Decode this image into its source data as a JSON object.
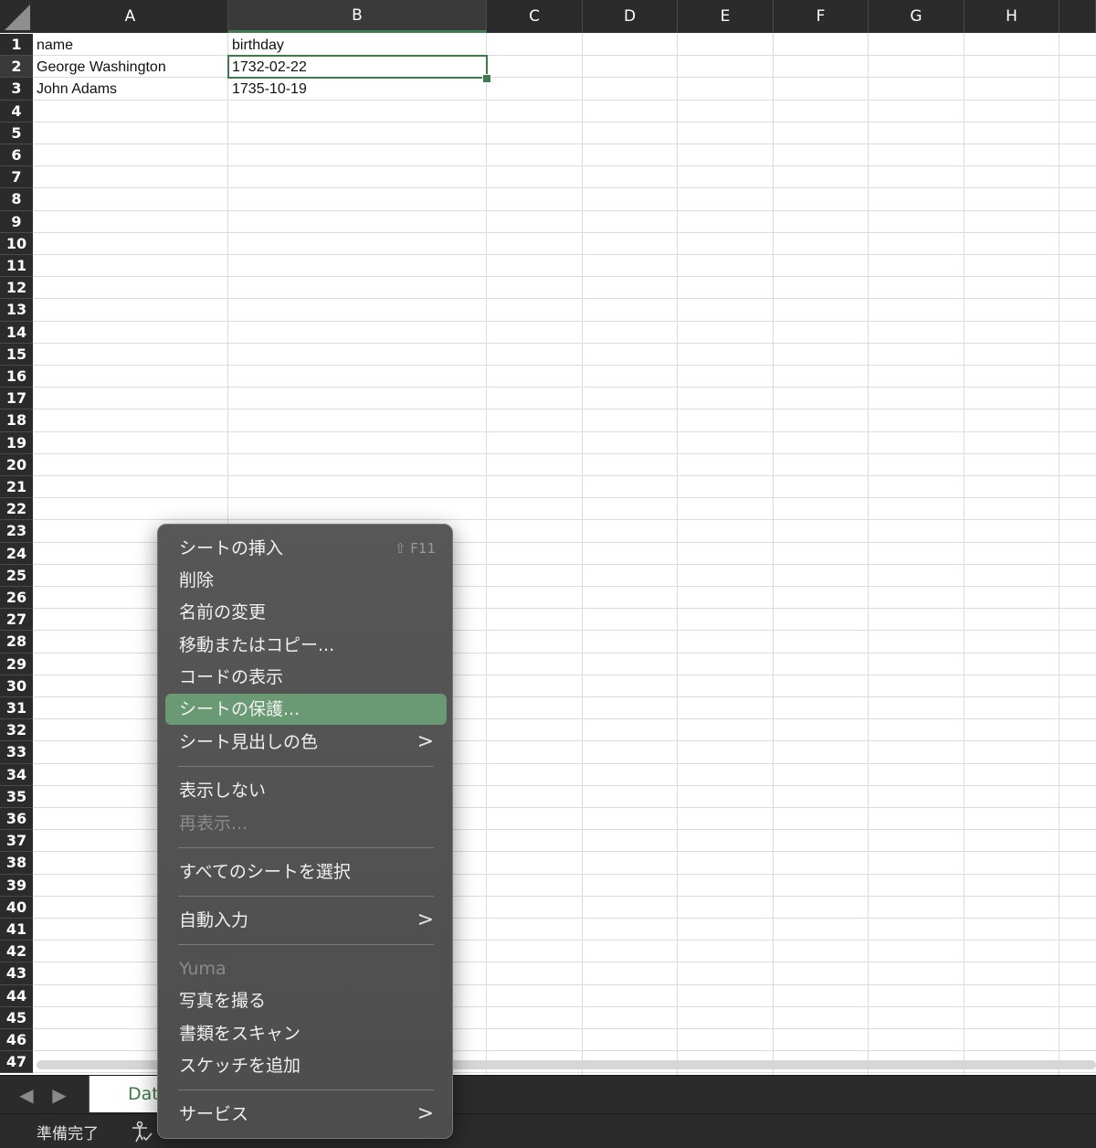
{
  "columns": [
    "A",
    "B",
    "C",
    "D",
    "E",
    "F",
    "G",
    "H"
  ],
  "rows": [
    "1",
    "2",
    "3",
    "4",
    "5",
    "6",
    "7",
    "8",
    "9",
    "10",
    "11",
    "12",
    "13",
    "14",
    "15",
    "16",
    "17",
    "18",
    "19",
    "20",
    "21",
    "22",
    "23",
    "24",
    "25",
    "26",
    "27",
    "28",
    "29",
    "30",
    "31",
    "32",
    "33",
    "34",
    "35",
    "36",
    "37",
    "38",
    "39",
    "40",
    "41",
    "42",
    "43",
    "44",
    "45",
    "46",
    "47"
  ],
  "cells": {
    "a1": "name",
    "b1": "birthday",
    "a2": "George Washington",
    "b2": "1732-02-22",
    "a3": "John Adams",
    "b3": "1735-10-19"
  },
  "sheet_tab": {
    "label": "Dat"
  },
  "status": {
    "text": "準備完了"
  },
  "context_menu": {
    "items": [
      {
        "label": "シートの挿入",
        "shortcut": "⇧ F11"
      },
      {
        "label": "削除"
      },
      {
        "label": "名前の変更"
      },
      {
        "label": "移動またはコピー..."
      },
      {
        "label": "コードの表示"
      },
      {
        "label": "シートの保護..."
      },
      {
        "label": "シート見出しの色",
        "submenu": ">"
      },
      {
        "label": "表示しない"
      },
      {
        "label": "再表示..."
      },
      {
        "label": "すべてのシートを選択"
      },
      {
        "label": "自動入力",
        "submenu": ">"
      },
      {
        "label": "Yuma"
      },
      {
        "label": "写真を撮る"
      },
      {
        "label": "書類をスキャン"
      },
      {
        "label": "スケッチを追加"
      },
      {
        "label": "サービス",
        "submenu": ">"
      }
    ]
  },
  "colors": {
    "accent": "#3e7a4b",
    "menu_highlight": "#6a9a74",
    "header_bg": "#2b2b2b"
  }
}
